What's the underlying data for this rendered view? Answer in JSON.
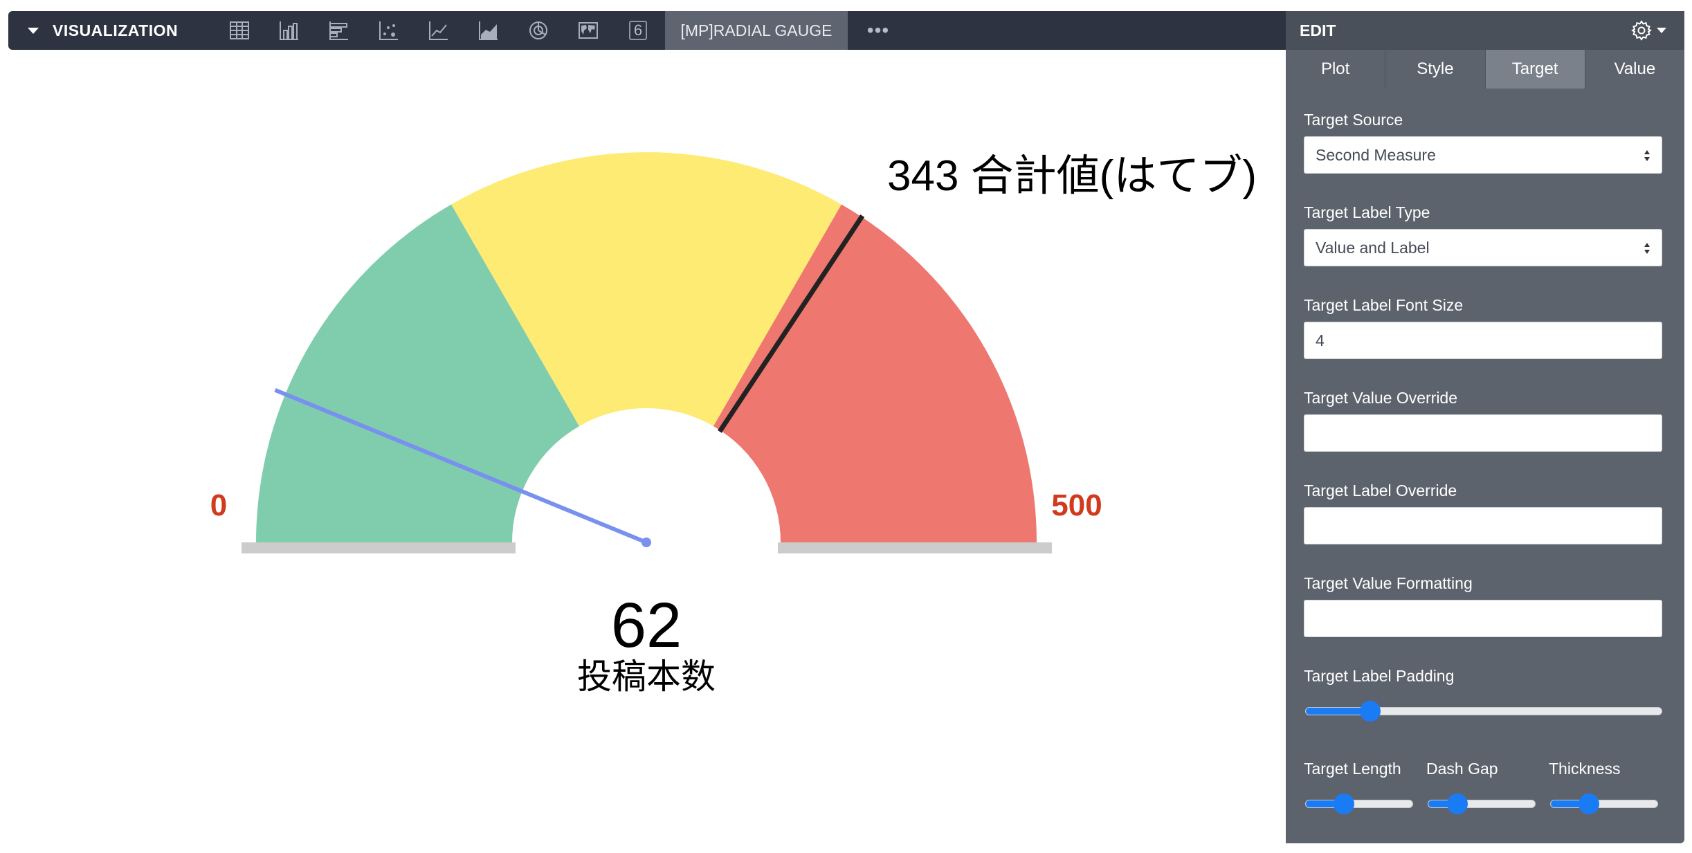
{
  "toolbar": {
    "title": "VISUALIZATION",
    "icons": [
      "table-icon",
      "column-chart-icon",
      "bar-chart-icon",
      "scatter-chart-icon",
      "line-chart-icon",
      "area-chart-icon",
      "pie-chart-icon",
      "map-icon"
    ],
    "single_value_label": "6",
    "active_tab": "[MP]RADIAL GAUGE",
    "more": "•••"
  },
  "gauge": {
    "min_label": "0",
    "max_label": "500",
    "value": "62",
    "value_label": "投稿本数",
    "target_text": "343 合計値(はてブ)",
    "colors": {
      "green": "#80cdae",
      "yellow": "#feeb73",
      "red": "#ee7770",
      "needle": "#7891ef",
      "target_line": "#222222",
      "base": "#cccccc",
      "range_label": "#d13a1c"
    }
  },
  "chart_data": {
    "type": "gauge",
    "min": 0,
    "max": 500,
    "value": 62,
    "value_label": "投稿本数",
    "target": 343,
    "target_label": "合計値(はてブ)",
    "bands": [
      {
        "from": 0,
        "to": 166.7,
        "color": "#80cdae"
      },
      {
        "from": 166.7,
        "to": 333.3,
        "color": "#feeb73"
      },
      {
        "from": 333.3,
        "to": 500,
        "color": "#ee7770"
      }
    ]
  },
  "edit": {
    "title": "EDIT",
    "tabs": [
      "Plot",
      "Style",
      "Target",
      "Value"
    ],
    "active_tab": "Target",
    "target_source": {
      "label": "Target Source",
      "value": "Second Measure"
    },
    "target_label_type": {
      "label": "Target Label Type",
      "value": "Value and Label"
    },
    "target_label_font_size": {
      "label": "Target Label Font Size",
      "value": "4"
    },
    "target_value_override": {
      "label": "Target Value Override",
      "value": ""
    },
    "target_label_override": {
      "label": "Target Label Override",
      "value": ""
    },
    "target_value_formatting": {
      "label": "Target Value Formatting",
      "value": ""
    },
    "target_label_padding": {
      "label": "Target Label Padding",
      "level": 0.18
    },
    "target_length": {
      "label": "Target Length",
      "level": 0.35
    },
    "dash_gap": {
      "label": "Dash Gap",
      "level": 0.27
    },
    "thickness": {
      "label": "Thickness",
      "level": 0.35
    }
  }
}
